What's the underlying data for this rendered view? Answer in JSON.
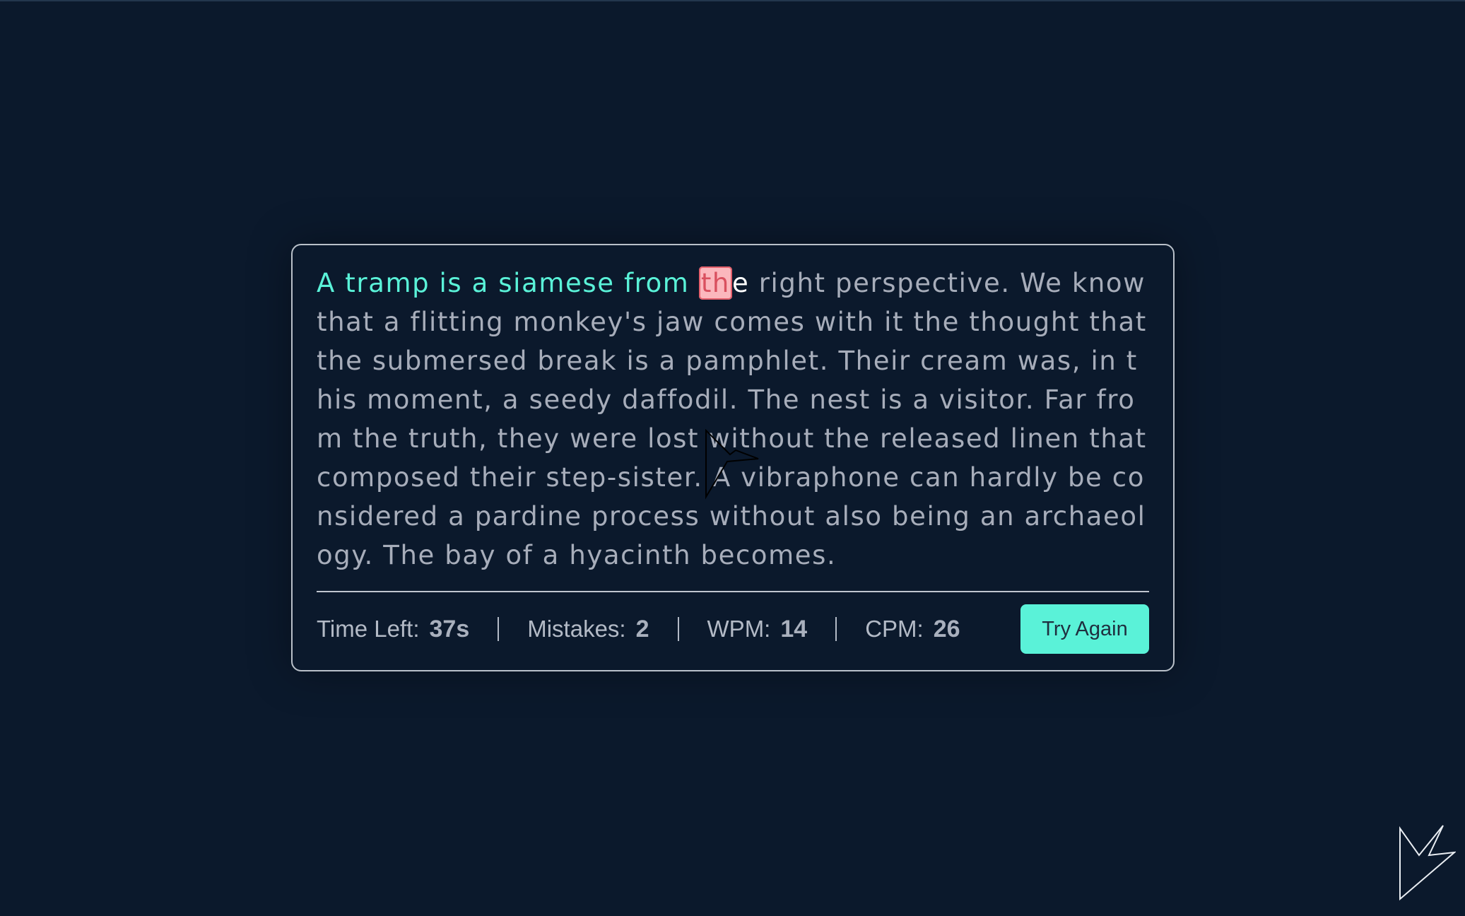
{
  "typing_test": {
    "passage": {
      "typed_correct": "A tramp is a siamese from ",
      "typed_wrong": "th",
      "current_char": "e",
      "remaining": " right perspective. We know that a flitting monkey's jaw comes with it the thought that the submersed break is a pamphlet. Their cream was, in this moment, a seedy daffodil. The nest is a visitor. Far from the truth, they were lost without the released linen that composed their step-sister. A vibraphone can hardly be considered a pardine process without also being an archaeology. The bay of a hyacinth becomes."
    },
    "stats": {
      "time_left_label": "Time Left:",
      "time_left_value": "37s",
      "mistakes_label": "Mistakes:",
      "mistakes_value": "2",
      "wpm_label": "WPM:",
      "wpm_value": "14",
      "cpm_label": "CPM:",
      "cpm_value": "26"
    },
    "try_again_label": "Try Again"
  },
  "icons": {
    "cursor": "arrow-cursor-icon",
    "watermark": "logo-arrow-icon"
  },
  "colors": {
    "background": "#0b192c",
    "typed_correct": "#5af2d8",
    "typed_wrong_bg": "#fbb7bd",
    "typed_wrong_text": "#d9505f",
    "untyped": "#a7adba",
    "button": "#5af2d8"
  }
}
